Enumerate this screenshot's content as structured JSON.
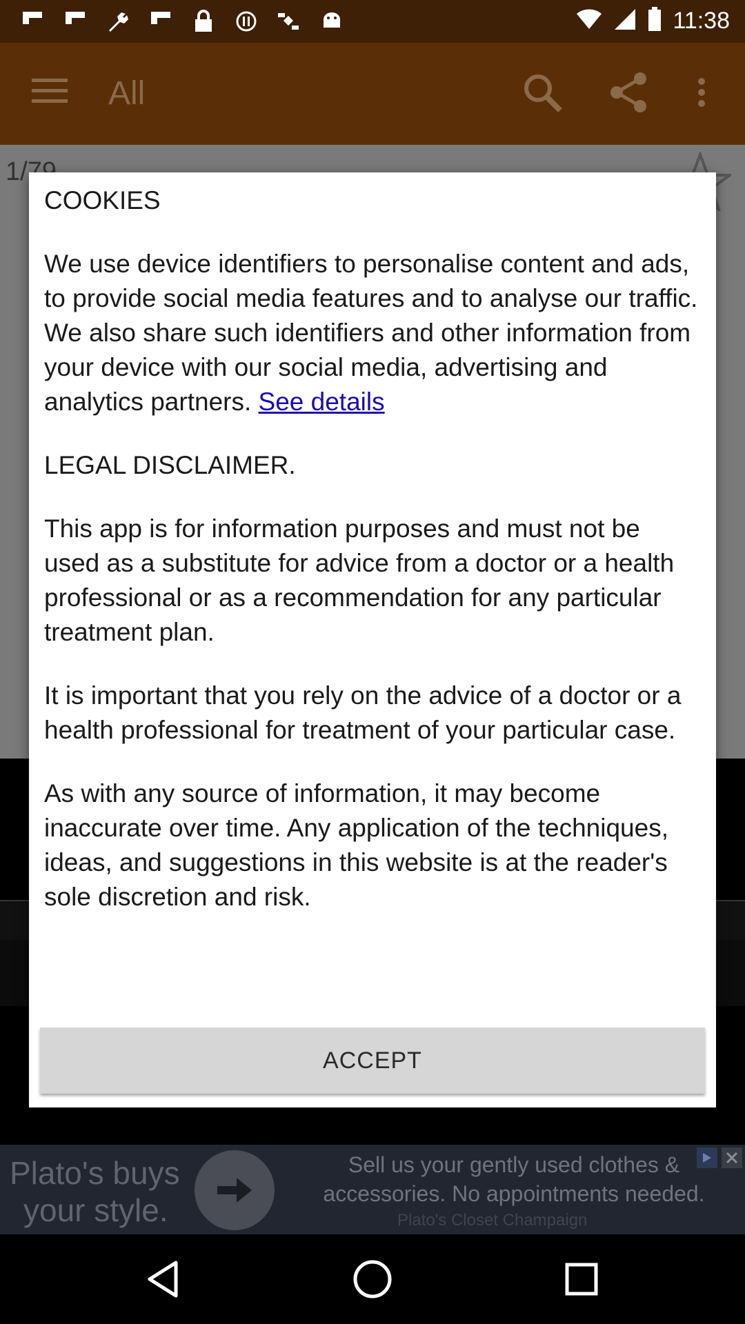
{
  "status_bar": {
    "time": "11:38"
  },
  "app_bar": {
    "title": "All"
  },
  "background": {
    "counter": "1/79"
  },
  "dialog": {
    "cookies_heading": "COOKIES",
    "cookies_text": "We use device identifiers to personalise content and ads, to provide social media features and to analyse our traffic. We also share such identifiers and other information from your device with our social media, advertising and analytics partners.",
    "see_details_link": "See details",
    "legal_heading": "LEGAL DISCLAIMER.",
    "legal_p1": "This app is for information purposes and must not be used as a substitute for advice from a doctor or a health professional or as a recommendation for any particular treatment plan.",
    "legal_p2": "It is important that you rely on the advice of a doctor or a health professional for treatment of your particular case.",
    "legal_p3": "As with any source of information, it may become inaccurate over time. Any application of the techniques, ideas, and suggestions in this website is at the reader's sole discretion and risk.",
    "accept_label": "ACCEPT"
  },
  "ad": {
    "left_line1": "Plato's buys",
    "left_line2": "your style.",
    "text": "Sell us your gently used clothes & accessories. No appointments needed.",
    "sub": "Plato's Closet Champaign"
  },
  "icons": {
    "status": [
      "flipboard-icon",
      "flipboard-icon",
      "wrench-icon",
      "flipboard-icon",
      "lock-icon",
      "pause-circle-icon",
      "satellite-icon",
      "android-icon"
    ],
    "app_bar": [
      "menu-icon",
      "search-icon",
      "share-icon",
      "more-vert-icon"
    ],
    "nav": [
      "back-icon",
      "home-icon",
      "recents-icon"
    ]
  },
  "colors": {
    "status_bar": "#3d2006",
    "app_bar": "#5a2f08",
    "link": "#1a0dab",
    "accept_bg": "#d6d6d6"
  }
}
